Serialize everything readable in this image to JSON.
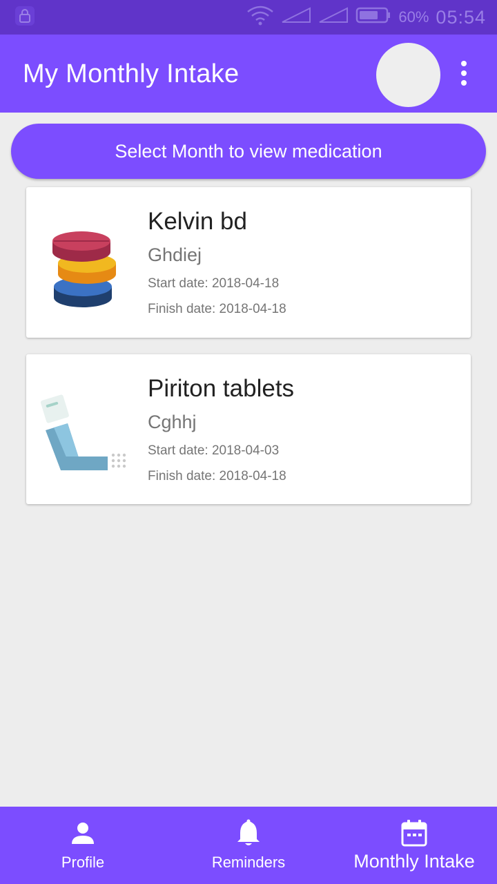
{
  "status_bar": {
    "battery_percent": "60%",
    "time": "05:54",
    "icons": [
      "lock-icon",
      "wifi-icon",
      "signal-icon",
      "signal-icon",
      "battery-icon"
    ]
  },
  "app_bar": {
    "title": "My Monthly Intake",
    "menu_icon": "more-vert-icon"
  },
  "select_month_button": "Select Month to view medication",
  "medications": [
    {
      "name": "Kelvin bd",
      "description": "Ghdiej",
      "start": "Start date: 2018-04-18",
      "finish": "Finish date: 2018-04-18",
      "icon": "pills-stack-icon"
    },
    {
      "name": "Piriton tablets",
      "description": "Cghhj",
      "start": "Start date: 2018-04-03",
      "finish": "Finish date: 2018-04-18",
      "icon": "inhaler-icon"
    }
  ],
  "bottom_nav": [
    {
      "label": "Profile",
      "icon": "person-icon"
    },
    {
      "label": "Reminders",
      "icon": "bell-icon"
    },
    {
      "label": "Monthly Intake",
      "icon": "calendar-icon",
      "active": true
    }
  ],
  "colors": {
    "primary": "#7c4dff",
    "status_bar": "#6034c9",
    "background": "#ededed"
  }
}
